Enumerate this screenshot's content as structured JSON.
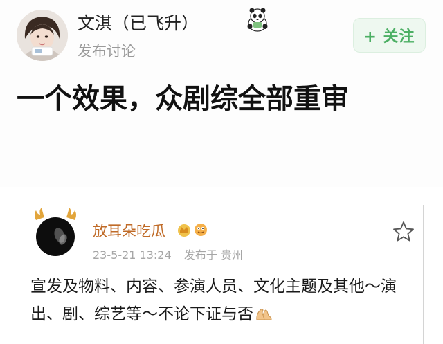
{
  "post": {
    "author_name": "文淇（已飞升）",
    "author_action": "发布讨论",
    "follow_label": "+ 关注",
    "title": "一个效果，众剧综全部重审"
  },
  "quoted": {
    "author_name": "放耳朵吃瓜",
    "timestamp": "23-5-21 13:24",
    "location": "发布于 贵州",
    "text": "宣发及物料、内容、参演人员、文化主题及其他～演出、剧、综艺等～不论下证与否"
  },
  "icons": {
    "panda": "panda-sticker-icon",
    "star": "star-outline-icon",
    "hands": "folded-hands-emoji-icon",
    "badges": "crown-badge-icon",
    "antlers": "antler-decoration-icon"
  },
  "colors": {
    "follow_text": "#4caf64",
    "follow_bg": "#eef8f0",
    "quoted_name": "#c06b28",
    "meta": "#a6a6a6"
  }
}
